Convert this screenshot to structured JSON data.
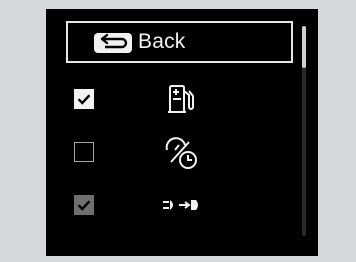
{
  "menu": {
    "back_label": "Back",
    "items": [
      {
        "icon": "fuel-pump-plus-icon",
        "checked": true,
        "enabled": true
      },
      {
        "icon": "speedometer-clock-icon",
        "checked": false,
        "enabled": true
      },
      {
        "icon": "headlight-dim-icon",
        "checked": true,
        "enabled": false
      }
    ]
  },
  "scroll": {
    "position": 0.0,
    "visible_fraction": 0.2
  },
  "colors": {
    "background": "#d7d8da",
    "screen": "#000000",
    "foreground": "#f1f1f1",
    "disabled": "#6f6f6f"
  }
}
